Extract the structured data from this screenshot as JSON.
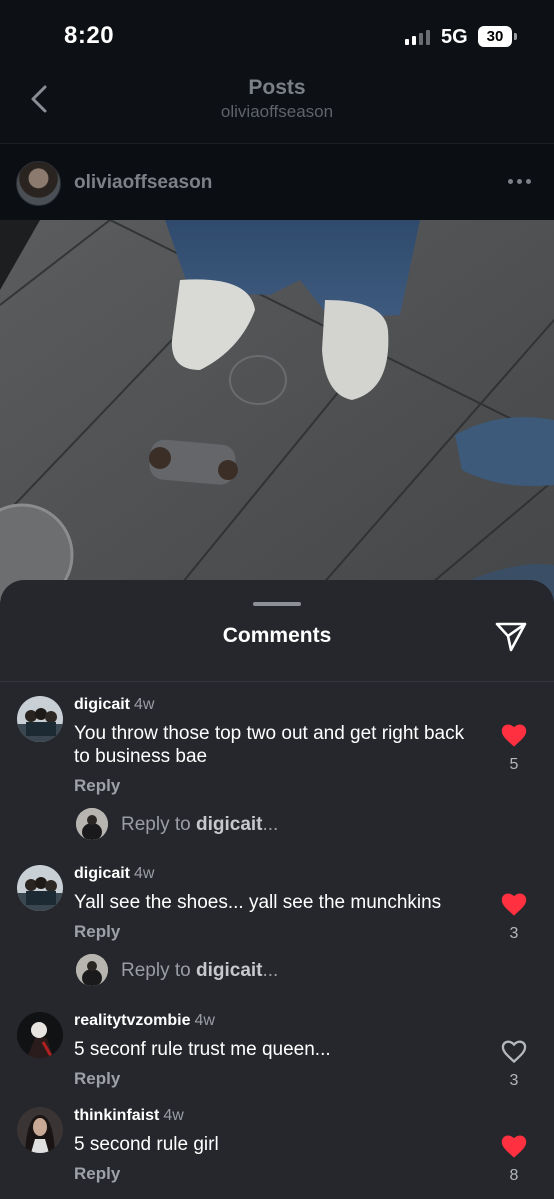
{
  "status_bar": {
    "time": "8:20",
    "network": "5G",
    "battery": "30"
  },
  "header": {
    "title": "Posts",
    "subtitle": "oliviaoffseason",
    "back_icon": "chevron-left-icon"
  },
  "post": {
    "author": "oliviaoffseason",
    "more_icon": "more-horizontal-icon"
  },
  "comments_sheet": {
    "title": "Comments",
    "share_icon": "send-icon",
    "comments": [
      {
        "user": "digicait",
        "time": "4w",
        "text": "You throw those top two out and get right back to business bae",
        "reply_label": "Reply",
        "likes": "5",
        "liked": true,
        "reply_prompt": {
          "prefix": "Reply to ",
          "user": "digicait",
          "suffix": "..."
        }
      },
      {
        "user": "digicait",
        "time": "4w",
        "text": "Yall see the shoes... yall see the munchkins",
        "reply_label": "Reply",
        "likes": "3",
        "liked": true,
        "reply_prompt": {
          "prefix": "Reply to ",
          "user": "digicait",
          "suffix": "..."
        }
      },
      {
        "user": "realitytvzombie",
        "time": "4w",
        "text": "5 seconf rule trust me queen...",
        "reply_label": "Reply",
        "likes": "3",
        "liked": false
      },
      {
        "user": "thinkinfaist",
        "time": "4w",
        "text": "5 second rule girl",
        "reply_label": "Reply",
        "likes": "8",
        "liked": true
      }
    ]
  },
  "colors": {
    "heart_liked": "#ff3040",
    "sheet_bg": "#25272c",
    "app_bg": "#0c0f13"
  }
}
